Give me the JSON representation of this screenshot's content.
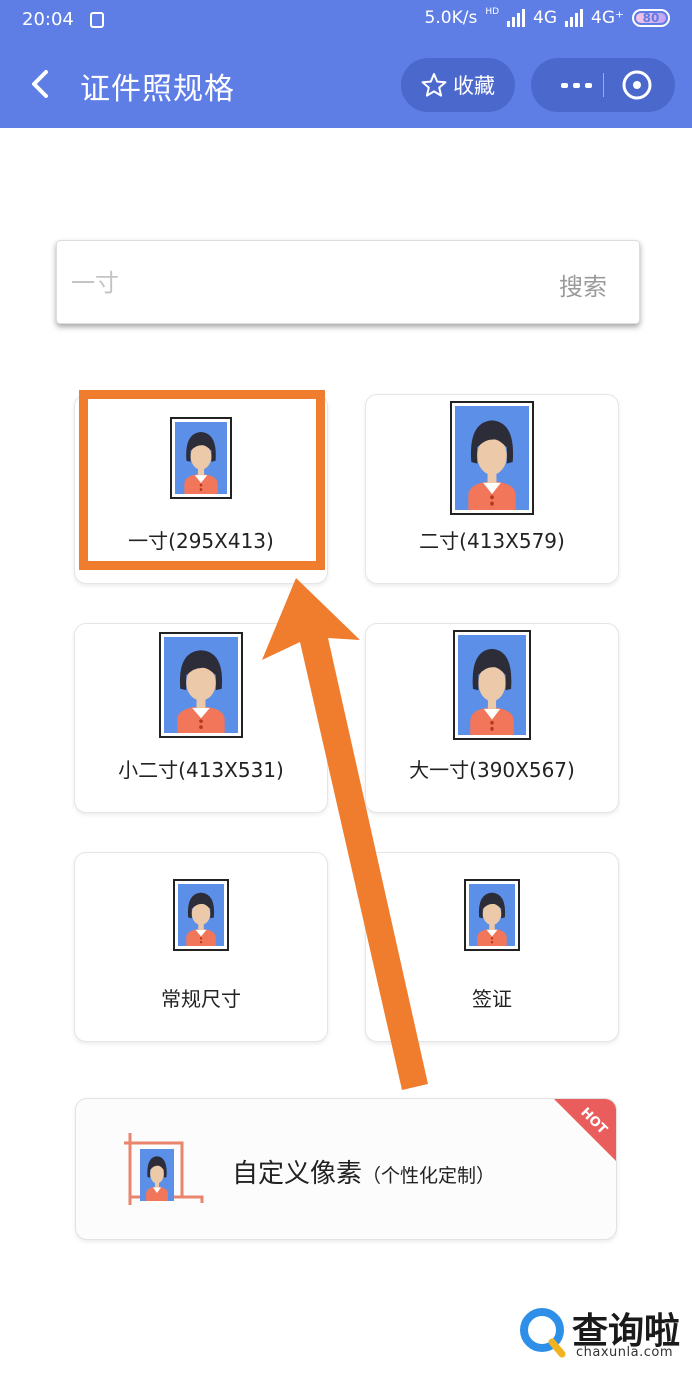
{
  "status_bar": {
    "time": "20:04",
    "net_speed": "5.0K/s",
    "hd_label": "HD",
    "net1": "4G",
    "net2": "4G⁺",
    "battery": "80"
  },
  "nav": {
    "title": "证件照规格",
    "favorite_label": "收藏"
  },
  "search": {
    "placeholder": "一寸",
    "button_label": "搜索"
  },
  "specs": [
    {
      "label": "一寸(295X413)"
    },
    {
      "label": "二寸(413X579)"
    },
    {
      "label": "小二寸(413X531)"
    },
    {
      "label": "大一寸(390X567)"
    },
    {
      "label": "常规尺寸"
    },
    {
      "label": "签证"
    }
  ],
  "custom": {
    "title": "自定义像素",
    "subtitle": "（个性化定制）",
    "badge": "HOT"
  },
  "watermark": {
    "name": "查询啦",
    "url": "chaxunla.com"
  },
  "colors": {
    "header": "#5e7ee6",
    "highlight": "#f07c2e",
    "photo_bg": "#5b8fe8",
    "shirt": "#f2775a"
  }
}
